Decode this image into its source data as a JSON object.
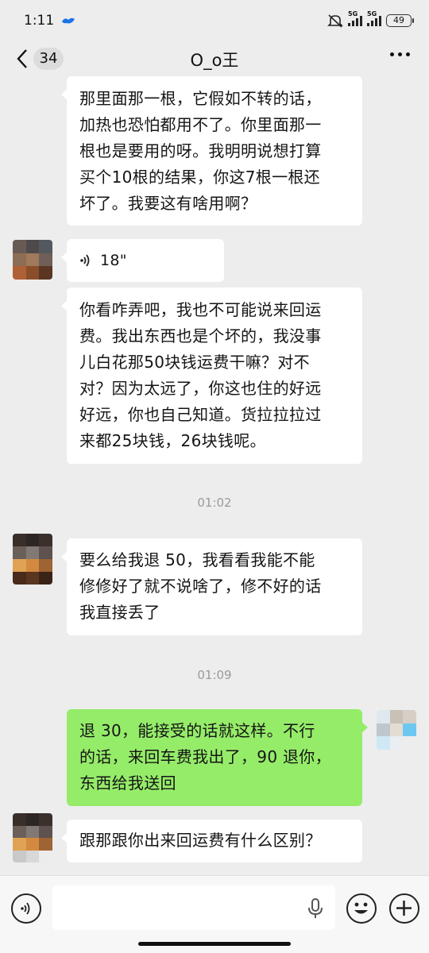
{
  "status_bar": {
    "time": "1:11",
    "network_1": "5G",
    "network_2": "5G",
    "battery": "49"
  },
  "header": {
    "unread_count": "34",
    "title": "O_o王"
  },
  "messages": [
    {
      "side": "left",
      "type": "text",
      "text": "那里面那一根，它假如不转的话，加热也恐怕都用不了。你里面那一根也是要用的呀。我明明说想打算买个10根的结果，你这7根一根还坏了。我要这有啥用啊？"
    },
    {
      "side": "left",
      "type": "voice",
      "duration": "18\""
    },
    {
      "side": "left",
      "type": "text",
      "text": "你看咋弄吧，我也不可能说来回运费。我出东西也是个坏的，我没事儿白花那50块钱运费干嘛？对不对？因为太远了，你这也住的好远好远，你也自己知道。货拉拉拉过来都25块钱，26块钱呢。"
    },
    {
      "type": "timestamp",
      "text": "01:02"
    },
    {
      "side": "left",
      "type": "text",
      "text": "要么给我退 50，我看看我能不能修修好了就不说啥了，修不好的话我直接丢了"
    },
    {
      "type": "timestamp",
      "text": "01:09"
    },
    {
      "side": "right",
      "type": "text",
      "text": "退 30，能接受的话就这样。不行的话，来回车费我出了，90 退你，东西给我送回"
    },
    {
      "side": "left",
      "type": "text",
      "text": "跟那跟你出来回运费有什么区别？"
    }
  ],
  "lines": {
    "m1": [
      "那里面那一根，它假如不转的话，",
      "加热也恐怕都用不了。你里面那一",
      "根也是要用的呀。我明明说想打算",
      "买个10根的结果，你这7根一根还",
      "坏了。我要这有啥用啊？"
    ],
    "m3": [
      "你看咋弄吧，我也不可能说来回运",
      "费。我出东西也是个坏的，我没事",
      "儿白花那50块钱运费干嘛？对不",
      "对？因为太远了，你这也住的好远",
      "好远，你也自己知道。货拉拉拉过",
      "来都25块钱，26块钱呢。"
    ],
    "m5": [
      "要么给我退 50，我看看我能不能",
      "修修好了就不说啥了，修不好的话",
      "我直接丢了"
    ],
    "m7": [
      "退 30，能接受的话就这样。不行",
      "的话，来回车费我出了，90 退你，",
      "东西给我送回"
    ],
    "m8": [
      "跟那跟你出来回运费有什么区别？"
    ]
  },
  "input_bar": {
    "placeholder": ""
  },
  "colors": {
    "background": "#ededed",
    "bubble_left": "#ffffff",
    "bubble_right": "#95ec69",
    "timestamp": "#9a9a9a"
  },
  "icons": [
    "back-chevron-icon",
    "more-icon",
    "voice-wave-icon",
    "voice-input-icon",
    "microphone-icon",
    "emoji-icon",
    "plus-icon"
  ]
}
